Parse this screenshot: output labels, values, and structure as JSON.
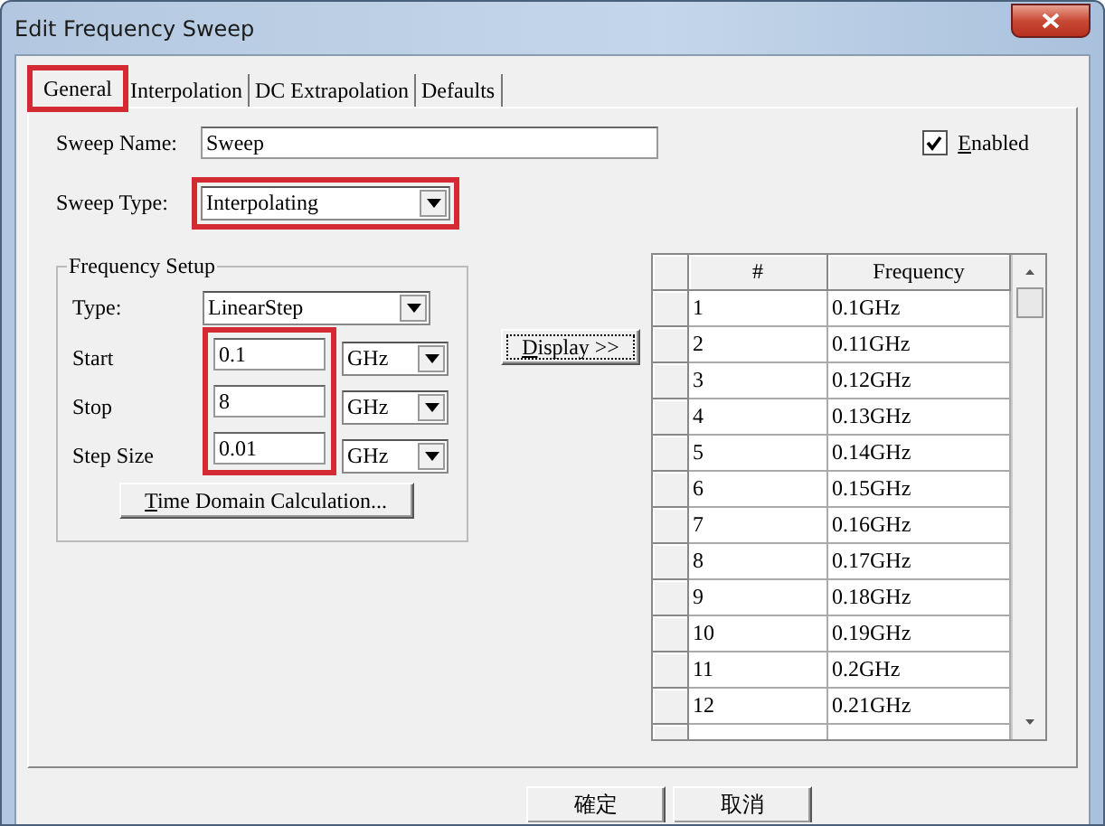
{
  "window": {
    "title": "Edit Frequency Sweep"
  },
  "tabs": [
    {
      "label": "General",
      "selected": true,
      "highlighted": true
    },
    {
      "label": "Interpolation",
      "selected": false,
      "highlighted": false
    },
    {
      "label": "DC Extrapolation",
      "selected": false,
      "highlighted": false
    },
    {
      "label": "Defaults",
      "selected": false,
      "highlighted": false
    }
  ],
  "sweep_name": {
    "label": "Sweep Name:",
    "value": "Sweep"
  },
  "enabled": {
    "label": "Enabled",
    "checked": true
  },
  "sweep_type": {
    "label": "Sweep Type:",
    "value": "Interpolating",
    "highlighted": true
  },
  "frequency_setup": {
    "title": "Frequency Setup",
    "type": {
      "label": "Type:",
      "value": "LinearStep"
    },
    "values_highlighted": true,
    "rows": [
      {
        "label": "Start",
        "value": "0.1",
        "unit": "GHz"
      },
      {
        "label": "Stop",
        "value": "8",
        "unit": "GHz"
      },
      {
        "label": "Step Size",
        "value": "0.01",
        "unit": "GHz"
      }
    ],
    "time_domain_button": "Time Domain Calculation..."
  },
  "display_button": "Display >>",
  "table": {
    "columns": [
      "#",
      "Frequency"
    ],
    "rows": [
      [
        "1",
        "0.1GHz"
      ],
      [
        "2",
        "0.11GHz"
      ],
      [
        "3",
        "0.12GHz"
      ],
      [
        "4",
        "0.13GHz"
      ],
      [
        "5",
        "0.14GHz"
      ],
      [
        "6",
        "0.15GHz"
      ],
      [
        "7",
        "0.16GHz"
      ],
      [
        "8",
        "0.17GHz"
      ],
      [
        "9",
        "0.18GHz"
      ],
      [
        "10",
        "0.19GHz"
      ],
      [
        "11",
        "0.2GHz"
      ],
      [
        "12",
        "0.21GHz"
      ]
    ]
  },
  "buttons": [
    "確定",
    "取消"
  ]
}
